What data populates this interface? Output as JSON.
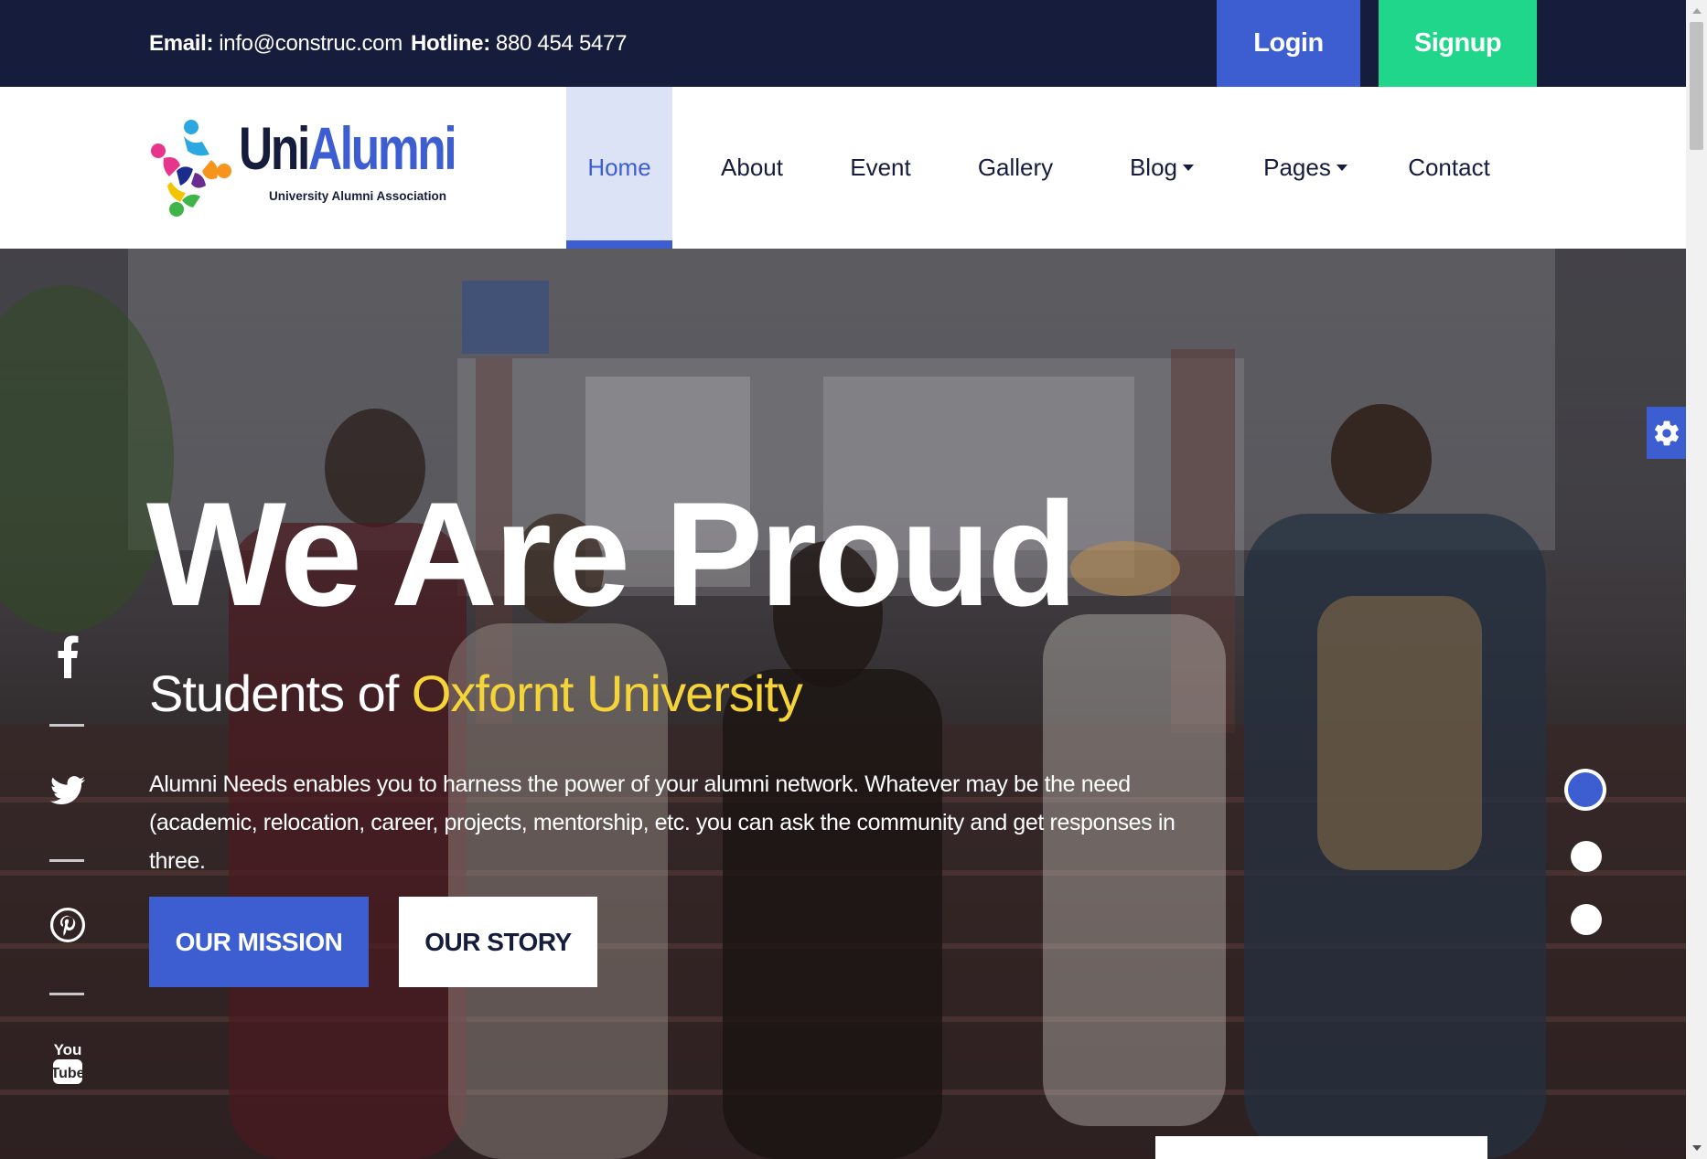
{
  "topbar": {
    "email_label": "Email:",
    "email_value": "info@construc.com",
    "hotline_label": "Hotline:",
    "hotline_value": "880 454 5477",
    "login_label": "Login",
    "signup_label": "Signup"
  },
  "logo": {
    "title_part1": "Uni",
    "title_part2": "Alumni",
    "subtitle": "University Alumni Association"
  },
  "nav": {
    "items": [
      {
        "label": "Home",
        "active": true
      },
      {
        "label": "About"
      },
      {
        "label": "Event"
      },
      {
        "label": "Gallery"
      },
      {
        "label": "Blog",
        "dropdown": true
      },
      {
        "label": "Pages",
        "dropdown": true
      },
      {
        "label": "Contact"
      }
    ]
  },
  "hero": {
    "title": "We Are Proud",
    "subtitle_prefix": "Students of ",
    "subtitle_highlight": "Oxfornt University",
    "description": "Alumni Needs enables you to harness the power of your alumni network. Whatever may be the need (academic, relocation, career, projects, mentorship, etc. you can ask the community and get responses in three.",
    "mission_button": "OUR MISSION",
    "story_button": "OUR STORY"
  },
  "social": {
    "icons": [
      "facebook-icon",
      "twitter-icon",
      "pinterest-icon",
      "youtube-icon"
    ]
  },
  "slider": {
    "dot_count": 3,
    "active_index": 0
  },
  "colors": {
    "primary": "#3d5ed0",
    "accent_green": "#20d68a",
    "navy": "#161c3b",
    "highlight_yellow": "#f5d43a"
  }
}
